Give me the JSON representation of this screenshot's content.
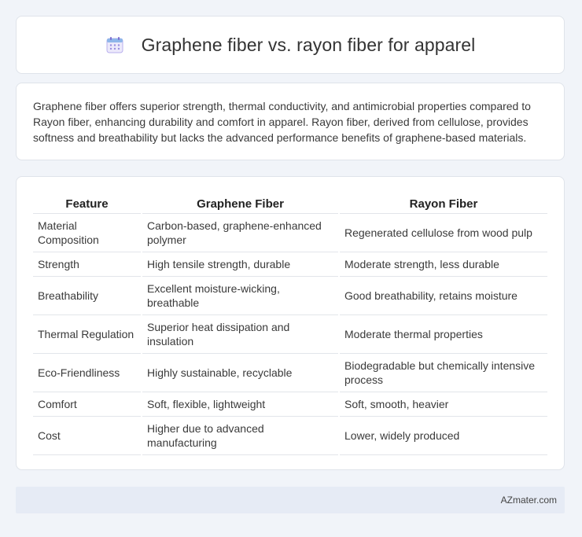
{
  "header": {
    "title": "Graphene fiber vs. rayon fiber for apparel",
    "icon": "calendar-icon"
  },
  "summary": "Graphene fiber offers superior strength, thermal conductivity, and antimicrobial properties compared to Rayon fiber, enhancing durability and comfort in apparel. Rayon fiber, derived from cellulose, provides softness and breathability but lacks the advanced performance benefits of graphene-based materials.",
  "table": {
    "headers": [
      "Feature",
      "Graphene Fiber",
      "Rayon Fiber"
    ],
    "rows": [
      [
        "Material Composition",
        "Carbon-based, graphene-enhanced polymer",
        "Regenerated cellulose from wood pulp"
      ],
      [
        "Strength",
        "High tensile strength, durable",
        "Moderate strength, less durable"
      ],
      [
        "Breathability",
        "Excellent moisture-wicking, breathable",
        "Good breathability, retains moisture"
      ],
      [
        "Thermal Regulation",
        "Superior heat dissipation and insulation",
        "Moderate thermal properties"
      ],
      [
        "Eco-Friendliness",
        "Highly sustainable, recyclable",
        "Biodegradable but chemically intensive process"
      ],
      [
        "Comfort",
        "Soft, flexible, lightweight",
        "Soft, smooth, heavier"
      ],
      [
        "Cost",
        "Higher due to advanced manufacturing",
        "Lower, widely produced"
      ]
    ]
  },
  "footer": {
    "brand": "AZmater.com"
  },
  "colors": {
    "page_bg": "#f1f4f9",
    "card_border": "#dfe3ea",
    "footer_bg": "#e6ebf5",
    "icon_accent": "#8b7fd6"
  }
}
